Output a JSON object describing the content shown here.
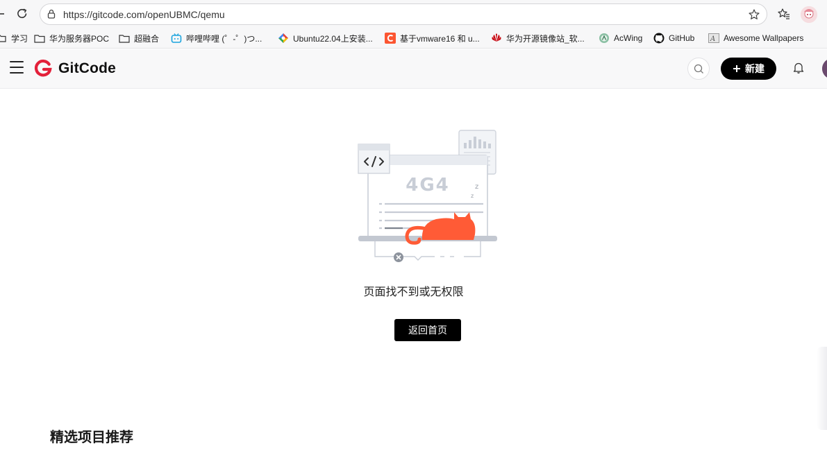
{
  "browser": {
    "url": "https://gitcode.com/openUBMC/qemu",
    "bookmarks": [
      {
        "label": "学习",
        "icon": "folder-icon"
      },
      {
        "label": "华为服务器POC",
        "icon": "folder-icon"
      },
      {
        "label": "超融合",
        "icon": "folder-icon"
      },
      {
        "label": "哔哩哔哩 (゜-゜)つ...",
        "icon": "bilibili-icon"
      },
      {
        "label": "Ubuntu22.04上安装...",
        "icon": "gcloud-icon"
      },
      {
        "label": "基于vmware16 和 u...",
        "icon": "csdn-icon"
      },
      {
        "label": "华为开源镜像站_软...",
        "icon": "huawei-icon"
      },
      {
        "label": "AcWing",
        "icon": "acwing-icon"
      },
      {
        "label": "GitHub",
        "icon": "github-icon"
      },
      {
        "label": "Awesome Wallpapers",
        "icon": "wallpaper-icon"
      }
    ]
  },
  "header": {
    "logo_text": "GitCode",
    "new_button_label": "新建"
  },
  "main": {
    "illustration_code": "4G4",
    "not_found_message": "页面找不到或无权限",
    "home_button_label": "返回首页",
    "section_title": "精选项目推荐"
  },
  "colors": {
    "brand_red": "#e3203a",
    "cat_orange": "#ff5b36",
    "black": "#000000"
  }
}
